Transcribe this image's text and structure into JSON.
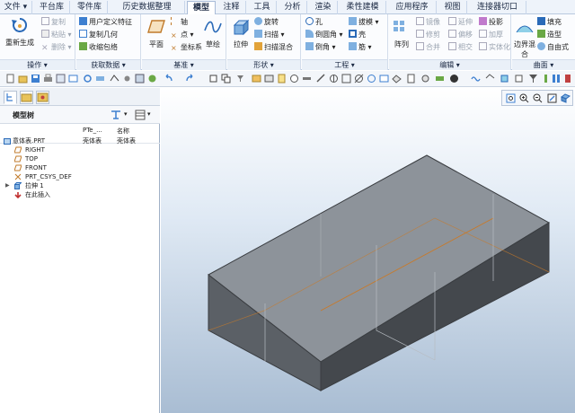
{
  "menu": {
    "tabs": [
      "文件",
      "平台库",
      "零件库",
      "历史数据整理",
      "模型",
      "注释",
      "工具",
      "分析",
      "渲染",
      "柔性建模",
      "应用程序",
      "视图",
      "连接器切口"
    ],
    "active_tab": "模型"
  },
  "ribbon": {
    "operations": {
      "label": "操作",
      "regenerate": "重新生成",
      "copy": "复制",
      "paste": "粘贴",
      "delete": "删除"
    },
    "get_data": {
      "label": "获取数据",
      "udf": "用户定义特征",
      "copy_geometry": "复制几何",
      "shrinkwrap": "收缩包络"
    },
    "datum": {
      "label": "基准",
      "plane": "平面",
      "axis": "轴",
      "point": "点",
      "csys": "坐标系",
      "sketch": "草绘"
    },
    "shapes": {
      "label": "形状",
      "extrude": "拉伸",
      "revolve": "旋转",
      "sweep": "扫描",
      "swept_blend": "扫描混合"
    },
    "engineering": {
      "label": "工程",
      "hole": "孔",
      "round": "倒圆角",
      "chamfer": "倒角",
      "draft": "拔模",
      "shell": "壳",
      "rib": "筋"
    },
    "editing": {
      "label": "编辑",
      "pattern": "阵列",
      "mirror": "镜像",
      "trim": "修剪",
      "merge": "合并",
      "extend": "延伸",
      "offset": "偏移",
      "intersect": "相交",
      "project": "投影",
      "thicken": "加厚",
      "solidify": "实体化"
    },
    "surfaces": {
      "label": "曲面",
      "boundary_blend": "边界混合",
      "fill": "填充",
      "style": "造型",
      "freestyle": "自由式"
    }
  },
  "model_tree": {
    "title": "模型树",
    "columns": [
      "PTe_...",
      "名称"
    ],
    "items": [
      {
        "label": "意体表.PRT",
        "col1": "壳体表",
        "col2": "壳体表",
        "icon": "part-icon"
      },
      {
        "label": "RIGHT",
        "col1": "",
        "col2": "",
        "icon": "datum-plane-icon"
      },
      {
        "label": "TOP",
        "col1": "",
        "col2": "",
        "icon": "datum-plane-icon"
      },
      {
        "label": "FRONT",
        "col1": "",
        "col2": "",
        "icon": "datum-plane-icon"
      },
      {
        "label": "PRT_CSYS_DEF",
        "col1": "",
        "col2": "",
        "icon": "csys-icon"
      },
      {
        "label": "拉伸 1",
        "col1": "",
        "col2": "",
        "icon": "extrude-feature-icon"
      },
      {
        "label": "在此插入",
        "col1": "",
        "col2": "",
        "icon": "insert-here-icon"
      }
    ]
  },
  "colors": {
    "accent": "#2a6ab8",
    "model_top": "#8d939a",
    "model_front": "#5b6066",
    "model_side": "#44484d",
    "edge_orange": "#c87a2a"
  }
}
